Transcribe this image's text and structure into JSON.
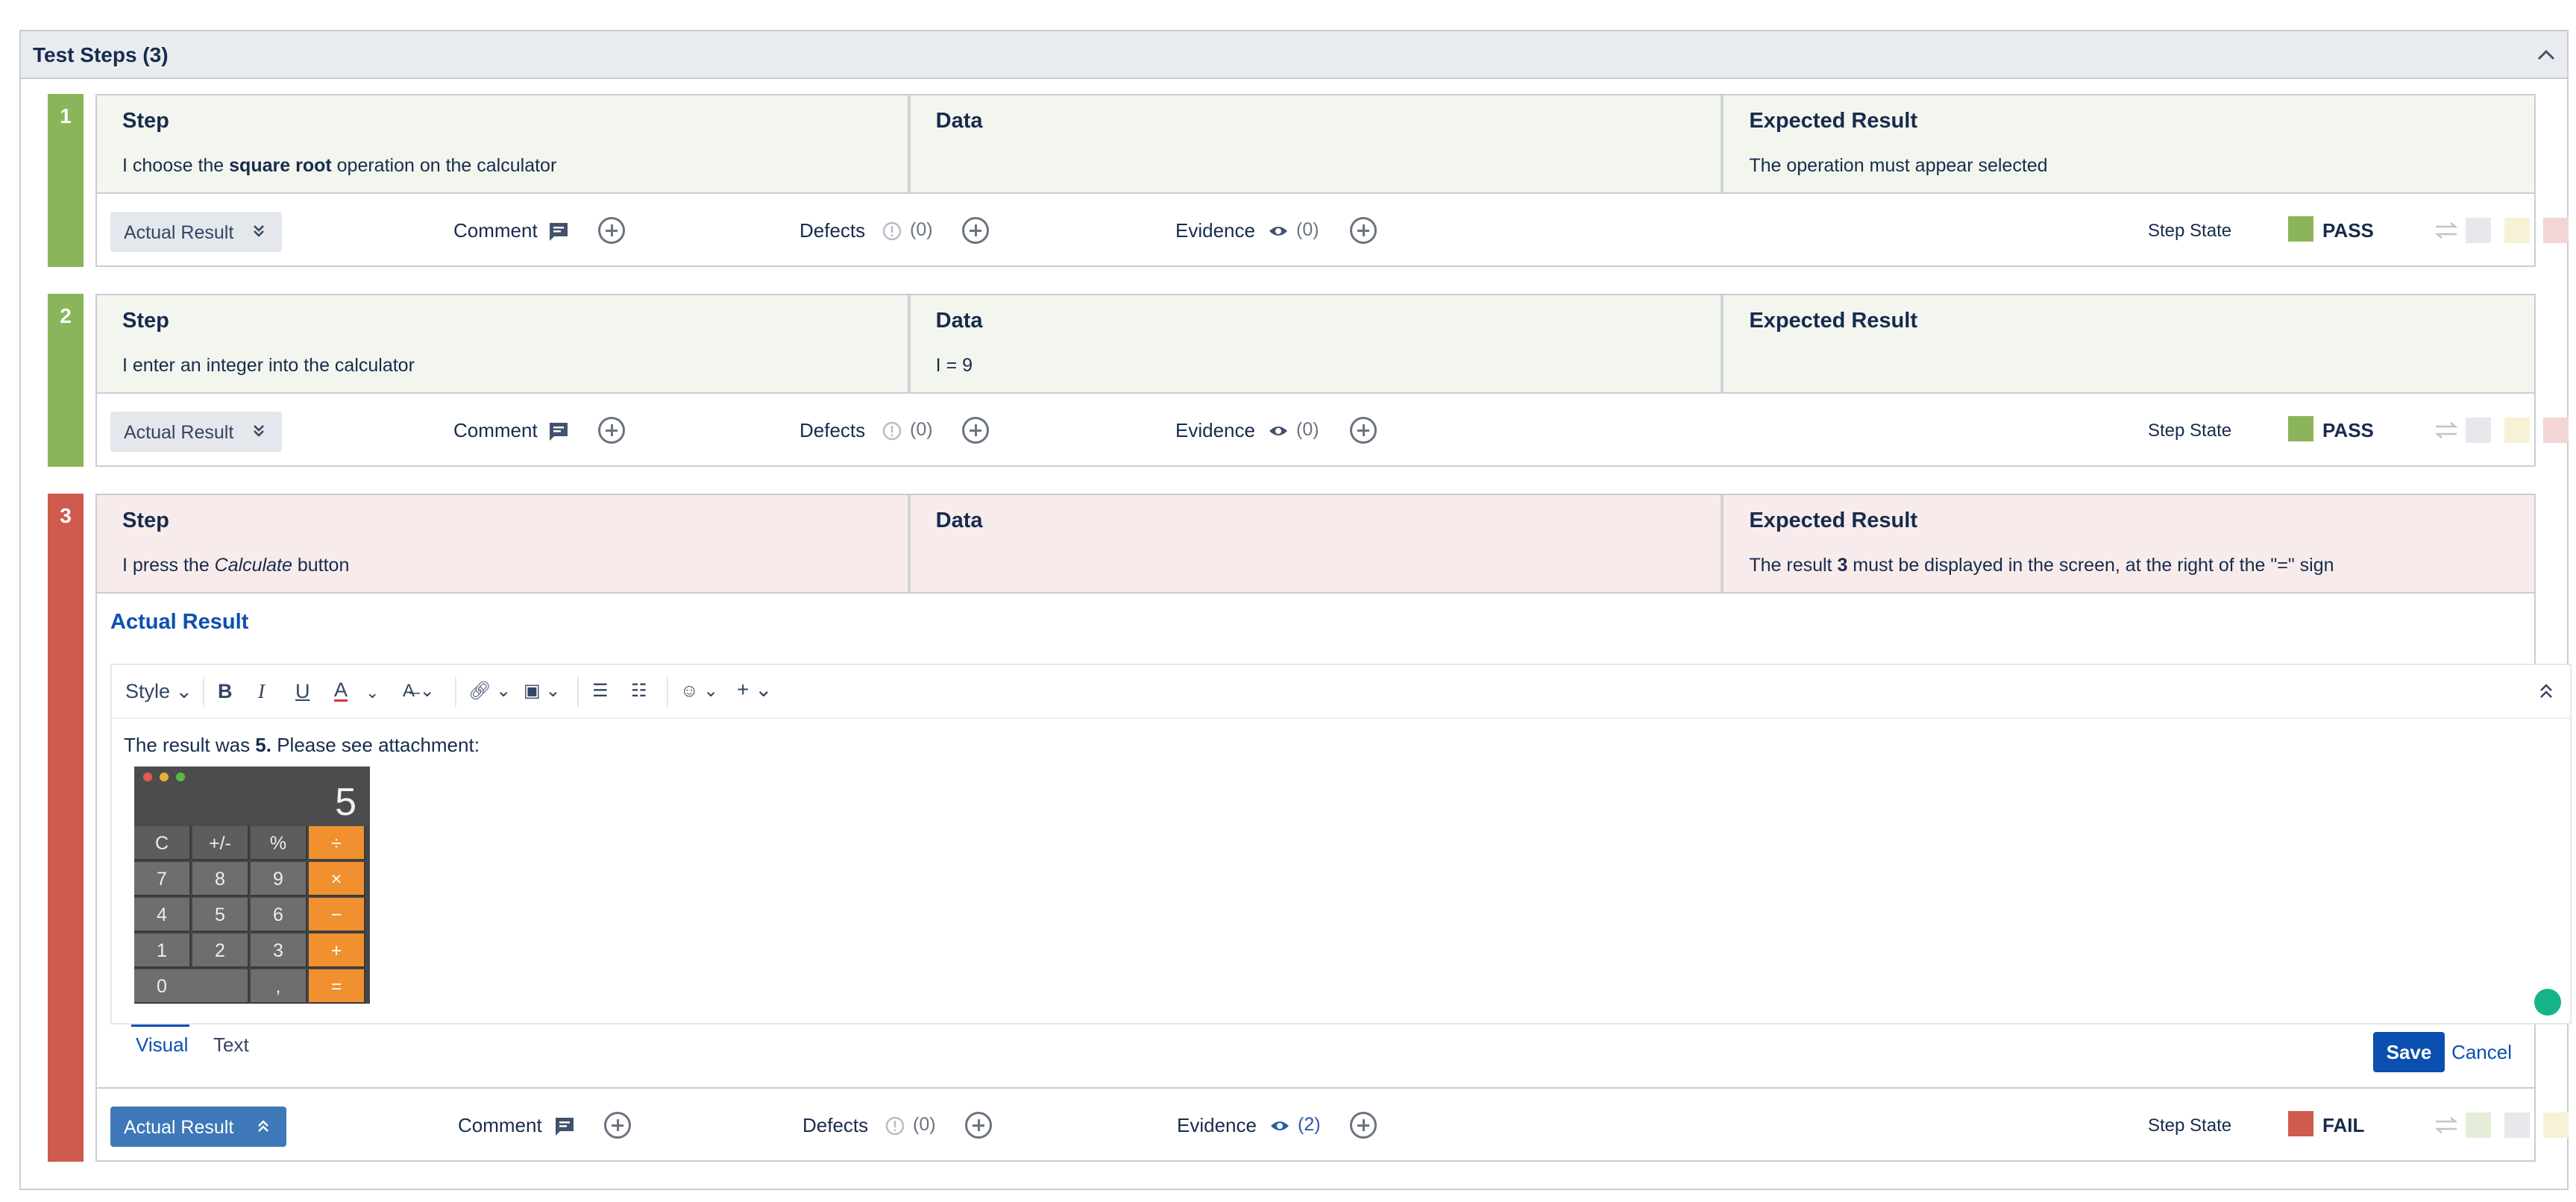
{
  "panel": {
    "title": "Test Steps (3)"
  },
  "columns": {
    "step": "Step",
    "data": "Data",
    "expected": "Expected Result"
  },
  "bar": {
    "actual_result": "Actual Result",
    "comment": "Comment",
    "defects": "Defects",
    "evidence": "Evidence",
    "step_state": "Step State"
  },
  "steps": [
    {
      "num": "1",
      "step_pre": "I choose the ",
      "step_em": "square root",
      "step_post": " operation on the calculator",
      "data": "",
      "expected_pre": "The operation must appear selected",
      "expected_b": "",
      "expected_post": "",
      "defects_count": "(0)",
      "evidence_count": "(0)",
      "state": "PASS",
      "state_color": "#8bb55a"
    },
    {
      "num": "2",
      "step_pre": "I enter an integer into the calculator",
      "step_em": "",
      "step_post": "",
      "data": "I = 9",
      "expected_pre": "",
      "expected_b": "",
      "expected_post": "",
      "defects_count": "(0)",
      "evidence_count": "(0)",
      "state": "PASS",
      "state_color": "#8bb55a"
    },
    {
      "num": "3",
      "step_pre": "I press the ",
      "step_em": "Calculate",
      "step_post": " button",
      "data": "",
      "expected_pre": "The result ",
      "expected_b": "3",
      "expected_post": " must be displayed in the screen, at the right of the \"=\" sign",
      "defects_count": "(0)",
      "evidence_count": "(2)",
      "state": "FAIL",
      "state_color": "#cf5a4e"
    }
  ],
  "editor": {
    "heading": "Actual Result",
    "style_label": "Style",
    "content_pre": "The result was ",
    "content_b": "5.",
    "content_post": " Please see attachment:",
    "tab_visual": "Visual",
    "tab_text": "Text",
    "save": "Save",
    "cancel": "Cancel"
  },
  "calculator": {
    "display": "5",
    "keys": [
      "C",
      "+/-",
      "%",
      "÷",
      "7",
      "8",
      "9",
      "×",
      "4",
      "5",
      "6",
      "−",
      "1",
      "2",
      "3",
      "+",
      "0",
      ",",
      "="
    ]
  }
}
